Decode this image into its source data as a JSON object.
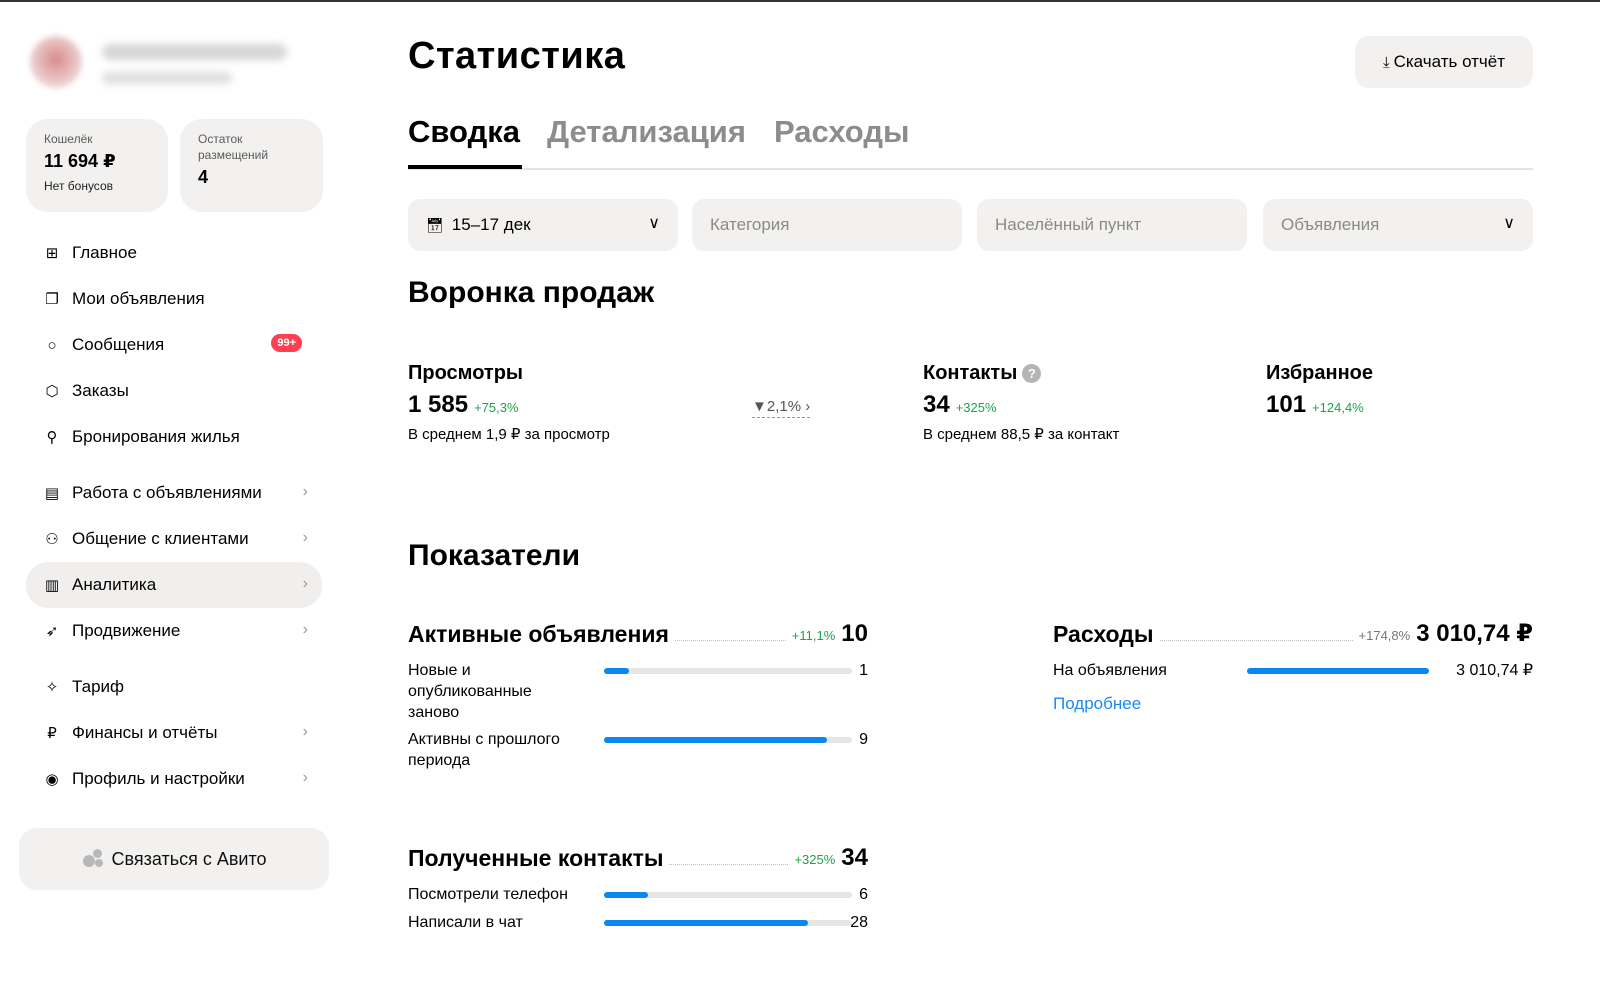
{
  "sidebar": {
    "wallet": {
      "label": "Кошелёк",
      "value": "11 694 ₽",
      "note": "Нет бонусов"
    },
    "remaining": {
      "label": "Остаток размещений",
      "value": "4"
    },
    "items": [
      {
        "label": "Главное",
        "icon": "grid-icon",
        "glyph": "⊞"
      },
      {
        "label": "Мои объявления",
        "icon": "copy-icon",
        "glyph": "❐"
      },
      {
        "label": "Сообщения",
        "icon": "chat-icon",
        "glyph": "○",
        "badge": "99+"
      },
      {
        "label": "Заказы",
        "icon": "box-icon",
        "glyph": "⬡"
      },
      {
        "label": "Бронирования жилья",
        "icon": "key-icon",
        "glyph": "⚲"
      },
      {
        "label": "Работа с объявлениями",
        "icon": "calendar-icon",
        "glyph": "▤"
      },
      {
        "label": "Общение с клиентами",
        "icon": "people-icon",
        "glyph": "⚇"
      },
      {
        "label": "Аналитика",
        "icon": "chart-icon",
        "glyph": "▥"
      },
      {
        "label": "Продвижение",
        "icon": "rocket-icon",
        "glyph": "➶"
      },
      {
        "label": "Тариф",
        "icon": "tariff-icon",
        "glyph": "✧"
      },
      {
        "label": "Финансы и отчёты",
        "icon": "ruble-icon",
        "glyph": "₽"
      },
      {
        "label": "Профиль и настройки",
        "icon": "profile-icon",
        "glyph": "◉"
      }
    ],
    "contact_label": "Связаться с Авито"
  },
  "header": {
    "title": "Статистика",
    "download_label": "Скачать отчёт",
    "download_icon": "download-icon"
  },
  "tabs": [
    "Сводка",
    "Детализация",
    "Расходы"
  ],
  "filters": {
    "date": "15–17 дек",
    "category_placeholder": "Категория",
    "city_placeholder": "Населённый пункт",
    "ads": "Объявления"
  },
  "funnel": {
    "title": "Воронка продаж",
    "views": {
      "label": "Просмотры",
      "value": "1 585",
      "delta": "+75,3%",
      "note": "В среднем 1,9 ₽ за просмотр"
    },
    "conversion": "2,1%",
    "contacts": {
      "label": "Контакты",
      "value": "34",
      "delta": "+325%",
      "note": "В среднем 88,5 ₽ за контакт"
    },
    "favorites": {
      "label": "Избранное",
      "value": "101",
      "delta": "+124,4%"
    }
  },
  "indicators": {
    "title": "Показатели",
    "active_ads": {
      "label": "Активные объявления",
      "delta": "+11,1%",
      "value": "10",
      "rows": [
        {
          "label": "Новые и опубликованные заново",
          "value": "1",
          "fraction": 0.1
        },
        {
          "label": "Активны с прошлого периода",
          "value": "9",
          "fraction": 0.9
        }
      ]
    },
    "expenses": {
      "label": "Расходы",
      "delta": "+174,8%",
      "value": "3 010,74 ₽",
      "rows": [
        {
          "label": "На объявления",
          "value": "3 010,74 ₽",
          "fraction": 1.0
        }
      ],
      "more_label": "Подробнее"
    },
    "contacts": {
      "label": "Полученные контакты",
      "delta": "+325%",
      "value": "34",
      "rows": [
        {
          "label": "Посмотрели телефон",
          "value": "6",
          "fraction": 0.1765
        },
        {
          "label": "Написали в чат",
          "value": "28",
          "fraction": 0.8235
        }
      ]
    }
  },
  "colors": {
    "accent_blue": "#0a88f0",
    "delta_green": "#1aa34a",
    "badge_red": "#ff4053",
    "card_bg": "#f2f1f0"
  }
}
